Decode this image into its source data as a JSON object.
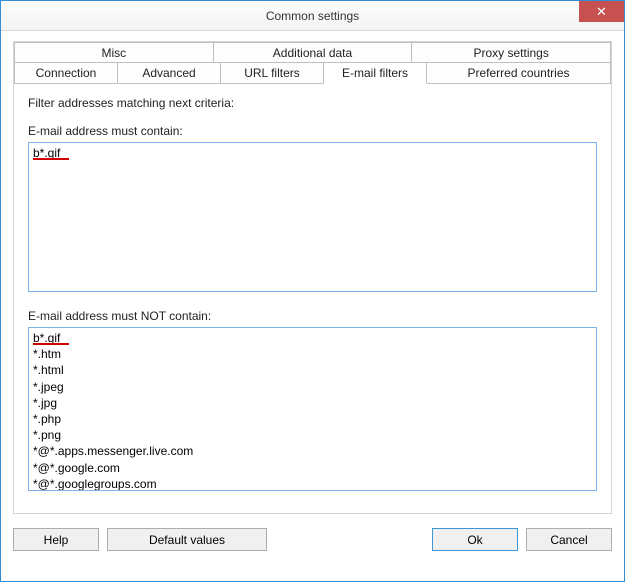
{
  "window": {
    "title": "Common settings"
  },
  "tabs_row1": [
    {
      "label": "Misc"
    },
    {
      "label": "Additional data"
    },
    {
      "label": "Proxy settings"
    }
  ],
  "tabs_row2": [
    {
      "label": "Connection"
    },
    {
      "label": "Advanced"
    },
    {
      "label": "URL filters"
    },
    {
      "label": "E-mail filters",
      "active": true
    },
    {
      "label": "Preferred countries"
    }
  ],
  "panel": {
    "intro": "Filter addresses matching next criteria:",
    "must_label": "E-mail address must contain:",
    "must_value": "b*.gif",
    "mustnot_label": "E-mail address must NOT contain:",
    "mustnot_value": "b*.gif\n*.htm\n*.html\n*.jpeg\n*.jpg\n*.php\n*.png\n*@*.apps.messenger.live.com\n*@*.google.com\n*@*.googlegroups.com\n*@company.com"
  },
  "buttons": {
    "help": "Help",
    "defaults": "Default values",
    "ok": "Ok",
    "cancel": "Cancel"
  }
}
